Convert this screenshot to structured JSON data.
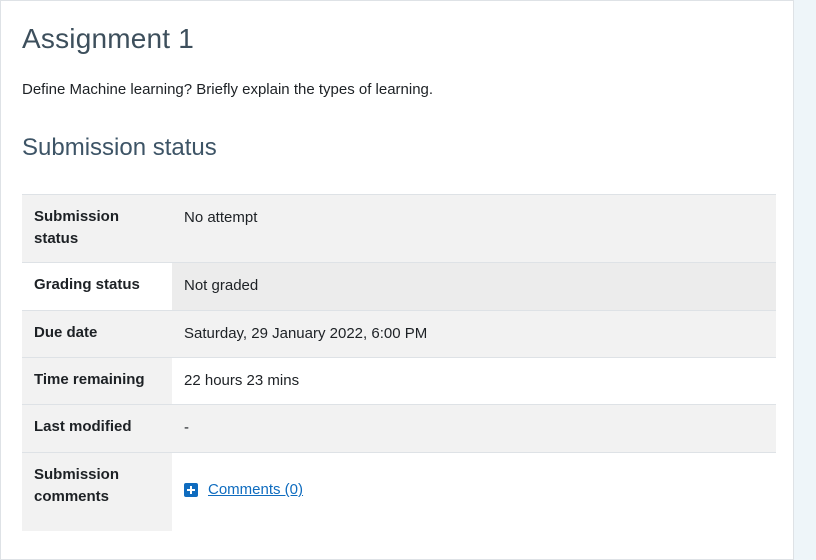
{
  "assignment": {
    "title": "Assignment 1",
    "description": "Define Machine learning? Briefly explain the types of learning."
  },
  "submission": {
    "section_title": "Submission status",
    "rows": [
      {
        "label": "Submission status",
        "value": "No attempt"
      },
      {
        "label": "Grading status",
        "value": "Not graded"
      },
      {
        "label": "Due date",
        "value": "Saturday, 29 January 2022, 6:00 PM"
      },
      {
        "label": "Time remaining",
        "value": "22 hours 23 mins"
      },
      {
        "label": "Last modified",
        "value": "-"
      },
      {
        "label": "Submission comments",
        "value": "Comments (0)"
      }
    ]
  },
  "colors": {
    "link": "#0f6cbf",
    "title": "#3d4f5c",
    "row_shade": "#f2f2f2"
  },
  "icons": {
    "comments_toggle": "plus-square-icon"
  }
}
